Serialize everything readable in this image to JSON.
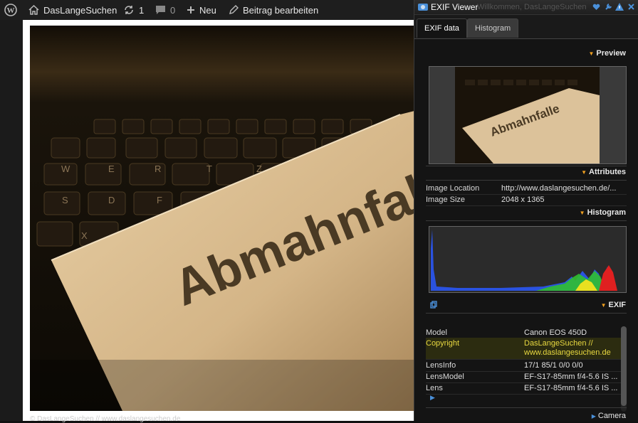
{
  "adminbar": {
    "site_name": "DasLangeSuchen",
    "updates_count": "1",
    "comments_count": "0",
    "new_label": "Neu",
    "edit_label": "Beitrag bearbeiten"
  },
  "photo": {
    "sign_text": "Abmahnfalle",
    "caption": "© DasLangeSuchen // www.daslangesuchen.de"
  },
  "exif_viewer": {
    "title": "EXIF Viewer",
    "ghost_text": "Willkommen, DasLangeSuchen",
    "tabs": [
      {
        "label": "EXIF data",
        "active": true
      },
      {
        "label": "Histogram",
        "active": false
      }
    ],
    "sections": {
      "preview": "Preview",
      "attributes": "Attributes",
      "histogram": "Histogram",
      "exif": "EXIF",
      "camera": "Camera"
    },
    "attributes": [
      {
        "key": "Image Location",
        "value": "http://www.daslangesuchen.de/..."
      },
      {
        "key": "Image Size",
        "value": "2048 x 1365"
      }
    ],
    "exif_rows": [
      {
        "key": "Model",
        "value": "Canon EOS 450D"
      },
      {
        "key": "Copyright",
        "value": "DasLangeSuchen //",
        "value2": "www.daslangesuchen.de"
      },
      {
        "key": "LensInfo",
        "value": "17/1 85/1 0/0 0/0"
      },
      {
        "key": "LensModel",
        "value": "EF-S17-85mm f/4-5.6 IS ..."
      },
      {
        "key": "Lens",
        "value": "EF-S17-85mm f/4-5.6 IS ..."
      }
    ]
  },
  "colors": {
    "accent_orange": "#f0a020",
    "highlight_yellow": "#e8d840",
    "titlebar_icon_blue": "#4a90d9"
  }
}
